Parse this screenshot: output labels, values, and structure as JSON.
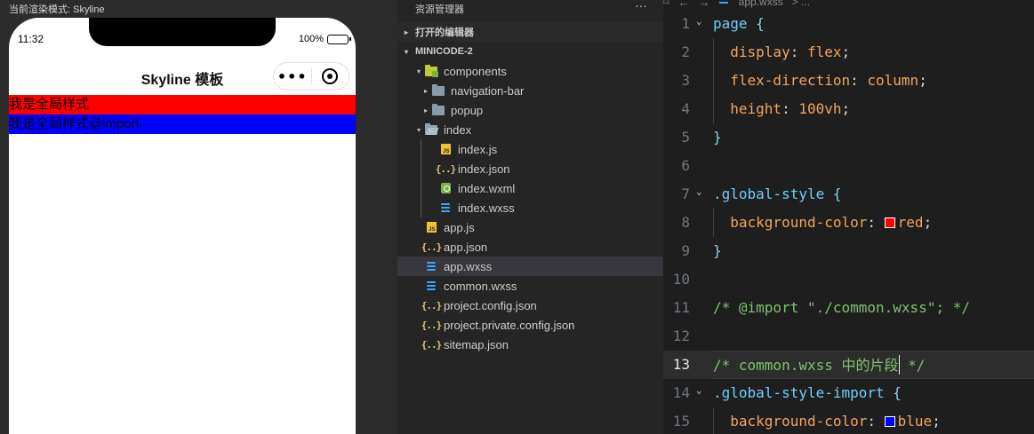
{
  "simulator": {
    "mode_label": "当前渲染模式: Skyline",
    "status_time": "11:32",
    "battery_text": "100%",
    "battery_level": 1.0,
    "nav_title": "Skyline 模板",
    "capsule_more": "•••",
    "row_global_style": "我是全局样式",
    "row_global_style_import": "我是全局样式@import",
    "colors": {
      "red": "#ff0000",
      "blue": "#0000ff"
    }
  },
  "explorer": {
    "header": "资源管理器",
    "more": "···",
    "open_editors": "打开的编辑器",
    "project": "MINICODE-2",
    "tree": [
      {
        "label": "components",
        "icon": "folder-components-icon",
        "chevron": "▾"
      },
      {
        "label": "navigation-bar",
        "icon": "folder-icon",
        "chevron": "▸"
      },
      {
        "label": "popup",
        "icon": "folder-icon",
        "chevron": "▸"
      },
      {
        "label": "index",
        "icon": "folder-open-icon",
        "chevron": "▾"
      },
      {
        "label": "index.js",
        "icon": "js-file-icon"
      },
      {
        "label": "index.json",
        "icon": "json-file-icon"
      },
      {
        "label": "index.wxml",
        "icon": "wxml-file-icon"
      },
      {
        "label": "index.wxss",
        "icon": "wxss-file-icon"
      },
      {
        "label": "app.js",
        "icon": "js-file-icon"
      },
      {
        "label": "app.json",
        "icon": "json-file-icon"
      },
      {
        "label": "app.wxss",
        "icon": "wxss-file-icon",
        "active": true
      },
      {
        "label": "common.wxss",
        "icon": "wxss-file-icon"
      },
      {
        "label": "project.config.json",
        "icon": "json-file-icon"
      },
      {
        "label": "project.private.config.json",
        "icon": "json-file-icon"
      },
      {
        "label": "sitemap.json",
        "icon": "json-file-icon"
      }
    ]
  },
  "editor": {
    "breadcrumb": {
      "file": "app.wxss",
      "trail": "> ..."
    },
    "current_line": 13,
    "lines": [
      {
        "n": "1",
        "fold": true,
        "tokens": [
          [
            "sel",
            "page"
          ],
          [
            "punct",
            " "
          ],
          [
            "brace",
            "{"
          ]
        ]
      },
      {
        "n": "2",
        "indent": true,
        "tokens": [
          [
            "prop",
            "  display"
          ],
          [
            "punct",
            ": "
          ],
          [
            "val",
            "flex"
          ],
          [
            "punct",
            ";"
          ]
        ]
      },
      {
        "n": "3",
        "indent": true,
        "tokens": [
          [
            "prop",
            "  flex-direction"
          ],
          [
            "punct",
            ": "
          ],
          [
            "val",
            "column"
          ],
          [
            "punct",
            ";"
          ]
        ]
      },
      {
        "n": "4",
        "indent": true,
        "tokens": [
          [
            "prop",
            "  height"
          ],
          [
            "punct",
            ": "
          ],
          [
            "num",
            "100vh"
          ],
          [
            "punct",
            ";"
          ]
        ]
      },
      {
        "n": "5",
        "tokens": [
          [
            "brace",
            "}"
          ]
        ]
      },
      {
        "n": "6",
        "tokens": []
      },
      {
        "n": "7",
        "fold": true,
        "tokens": [
          [
            "sel",
            ".global-style"
          ],
          [
            "punct",
            " "
          ],
          [
            "brace",
            "{"
          ]
        ]
      },
      {
        "n": "8",
        "indent": true,
        "tokens": [
          [
            "prop",
            "  background-color"
          ],
          [
            "punct",
            ": "
          ],
          [
            "swatch",
            "#ff0000"
          ],
          [
            "val",
            "red"
          ],
          [
            "punct",
            ";"
          ]
        ]
      },
      {
        "n": "9",
        "tokens": [
          [
            "brace",
            "}"
          ]
        ]
      },
      {
        "n": "10",
        "tokens": []
      },
      {
        "n": "11",
        "tokens": [
          [
            "comment",
            "/* @import \"./common.wxss\"; */"
          ]
        ]
      },
      {
        "n": "12",
        "tokens": []
      },
      {
        "n": "13",
        "tokens": [
          [
            "comment",
            "/* common.wxss 中的片段"
          ],
          [
            "cursor",
            ""
          ],
          [
            "comment",
            " */"
          ]
        ]
      },
      {
        "n": "14",
        "fold": true,
        "tokens": [
          [
            "sel",
            ".global-style-import"
          ],
          [
            "punct",
            " "
          ],
          [
            "brace",
            "{"
          ]
        ]
      },
      {
        "n": "15",
        "indent": true,
        "tokens": [
          [
            "prop",
            "  background-color"
          ],
          [
            "punct",
            ": "
          ],
          [
            "swatch",
            "#0000ff"
          ],
          [
            "val",
            "blue"
          ],
          [
            "punct",
            ";"
          ]
        ]
      }
    ]
  }
}
